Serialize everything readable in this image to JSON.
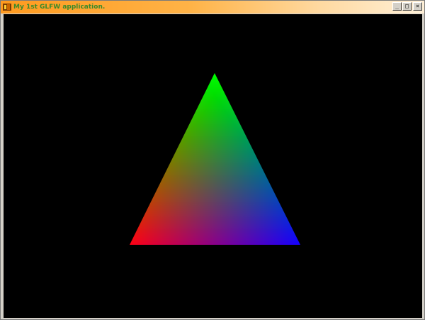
{
  "window": {
    "title": "My 1st GLFW application.",
    "app_icon": "glfw-app-icon",
    "buttons": {
      "minimize": {
        "icon": "minimize-icon",
        "glyph": "_"
      },
      "maximize": {
        "icon": "maximize-icon",
        "glyph": "□"
      },
      "close": {
        "icon": "close-icon",
        "glyph": "×"
      }
    }
  },
  "scene": {
    "background": "#000000",
    "triangle_vertex_colors": {
      "top": "#00ff00",
      "bottom_left": "#ff0000",
      "bottom_right": "#0000ff"
    }
  }
}
